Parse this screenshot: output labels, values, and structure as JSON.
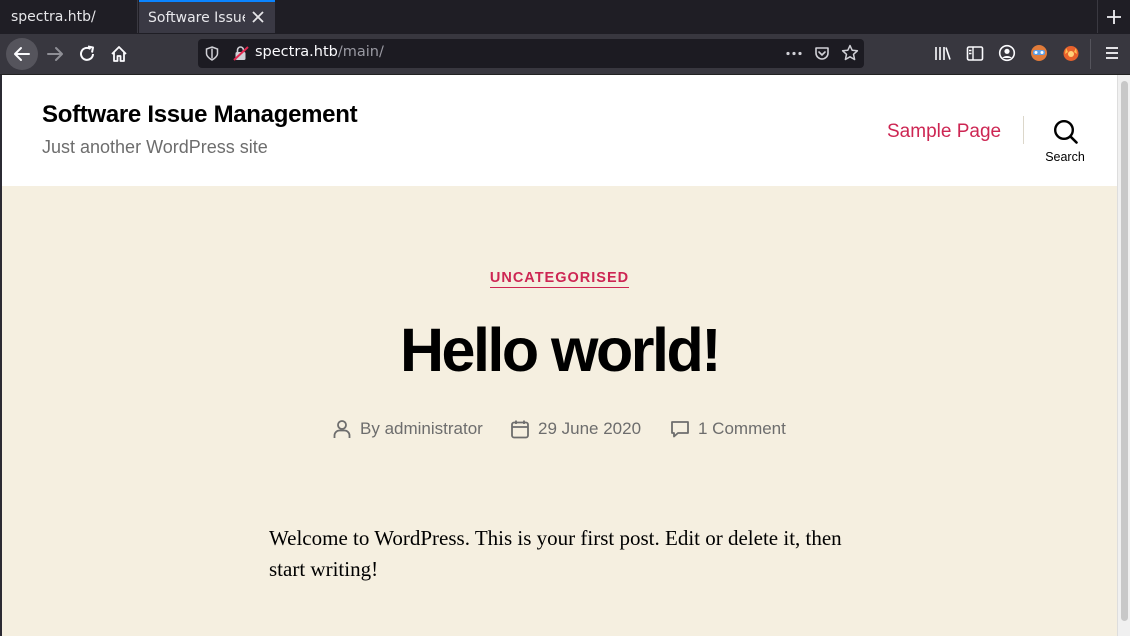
{
  "browser": {
    "tabs": [
      {
        "title": "spectra.htb/",
        "active": false
      },
      {
        "title": "Software Issue Management",
        "active": true
      }
    ],
    "url": {
      "host": "spectra.htb",
      "path": "/main/"
    }
  },
  "site": {
    "title": "Software Issue Management",
    "description": "Just another WordPress site",
    "nav": {
      "sample_page": "Sample Page",
      "search_label": "Search"
    }
  },
  "post": {
    "category": "UNCATEGORISED",
    "title": "Hello world!",
    "author_prefix": "By",
    "author": "administrator",
    "date": "29 June 2020",
    "comments": "1 Comment",
    "body": "Welcome to WordPress. This is your first post. Edit or delete it, then start writing!"
  },
  "colors": {
    "accent": "#cd2653",
    "page_bg": "#f5efe0",
    "header_bg": "#ffffff",
    "browser_chrome": "#38373f"
  },
  "icons": [
    "back-icon",
    "forward-icon",
    "reload-icon",
    "home-icon",
    "shield-icon",
    "insecure-lock-icon",
    "page-actions-icon",
    "pocket-icon",
    "bookmark-star-icon",
    "library-icon",
    "sidebar-icon",
    "account-icon",
    "extension-icon",
    "firefox-extension-icon",
    "menu-icon",
    "close-icon",
    "new-tab-icon",
    "search-icon",
    "user-icon",
    "calendar-icon",
    "comment-icon"
  ]
}
